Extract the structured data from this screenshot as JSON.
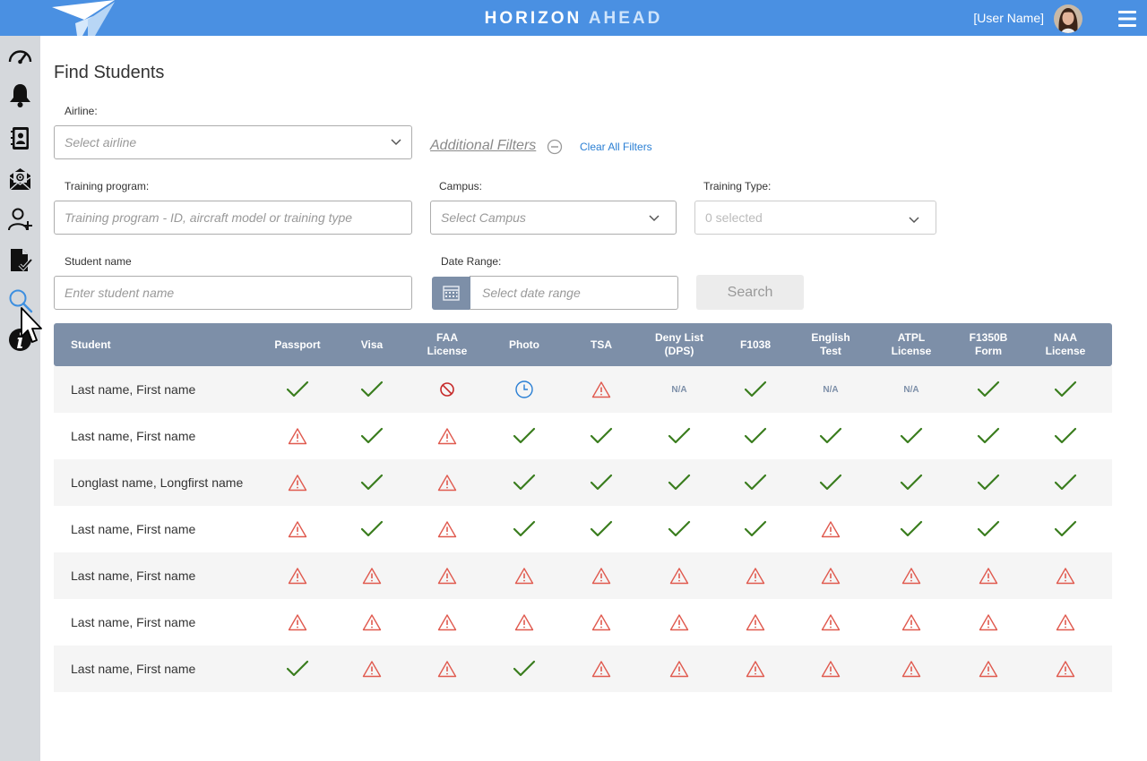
{
  "header": {
    "brand_part1": "HORIZON",
    "brand_part2": "AHEAD",
    "user_name": "[User Name]"
  },
  "sidebar": {
    "items": [
      {
        "icon": "speedometer-icon"
      },
      {
        "icon": "bell-icon"
      },
      {
        "icon": "contact-book-icon"
      },
      {
        "icon": "mail-icon"
      },
      {
        "icon": "add-user-icon"
      },
      {
        "icon": "document-check-icon"
      },
      {
        "icon": "search-icon",
        "active": true
      },
      {
        "icon": "info-icon"
      }
    ]
  },
  "page": {
    "title": "Find Students"
  },
  "filters": {
    "airline_label": "Airline:",
    "airline_placeholder": "Select airline",
    "additional_filters": "Additional Filters",
    "clear_all": "Clear All Filters",
    "training_program_label": "Training program:",
    "training_program_placeholder": "Training program - ID, aircraft model or training type",
    "campus_label": "Campus:",
    "campus_placeholder": "Select Campus",
    "training_type_label": "Training Type:",
    "training_type_value": "0 selected",
    "student_name_label": "Student name",
    "student_name_placeholder": "Enter student name",
    "date_range_label": "Date Range:",
    "date_range_placeholder": "Select date range",
    "search_label": "Search"
  },
  "table": {
    "columns": [
      {
        "label": "Student"
      },
      {
        "label": "Passport"
      },
      {
        "label": "Visa"
      },
      {
        "label": "FAA\nLicense"
      },
      {
        "label": "Photo"
      },
      {
        "label": "TSA"
      },
      {
        "label": "Deny List\n(DPS)"
      },
      {
        "label": "F1038"
      },
      {
        "label": "English\nTest"
      },
      {
        "label": "ATPL\nLicense"
      },
      {
        "label": "F1350B\nForm"
      },
      {
        "label": "NAA\nLicense"
      }
    ],
    "na_text": "N/A",
    "rows": [
      {
        "name": "Last name, First name",
        "statuses": [
          "check",
          "check",
          "denied",
          "pending",
          "warning",
          "na",
          "check",
          "na",
          "na",
          "check",
          "check"
        ]
      },
      {
        "name": "Last name, First name",
        "statuses": [
          "warning",
          "check",
          "warning",
          "check",
          "check",
          "check",
          "check",
          "check",
          "check",
          "check",
          "check"
        ]
      },
      {
        "name": "Longlast name, Longfirst name",
        "statuses": [
          "warning",
          "check",
          "warning",
          "check",
          "check",
          "check",
          "check",
          "check",
          "check",
          "check",
          "check"
        ]
      },
      {
        "name": "Last name, First name",
        "statuses": [
          "warning",
          "check",
          "warning",
          "check",
          "check",
          "check",
          "check",
          "warning",
          "check",
          "check",
          "check"
        ]
      },
      {
        "name": "Last name, First name",
        "statuses": [
          "warning",
          "warning",
          "warning",
          "warning",
          "warning",
          "warning",
          "warning",
          "warning",
          "warning",
          "warning",
          "warning"
        ]
      },
      {
        "name": "Last name, First name",
        "statuses": [
          "warning",
          "warning",
          "warning",
          "warning",
          "warning",
          "warning",
          "warning",
          "warning",
          "warning",
          "warning",
          "warning"
        ]
      },
      {
        "name": "Last name, First name",
        "statuses": [
          "check",
          "warning",
          "warning",
          "check",
          "warning",
          "warning",
          "warning",
          "warning",
          "warning",
          "warning",
          "warning"
        ]
      }
    ]
  },
  "colors": {
    "header_bg": "#4a90e2",
    "sidebar_bg": "#d5d8dc",
    "table_header_bg": "#7d8fa8",
    "check": "#3a7d1e",
    "warning": "#e05a4f",
    "denied": "#c62828",
    "pending": "#2a7fd4"
  }
}
